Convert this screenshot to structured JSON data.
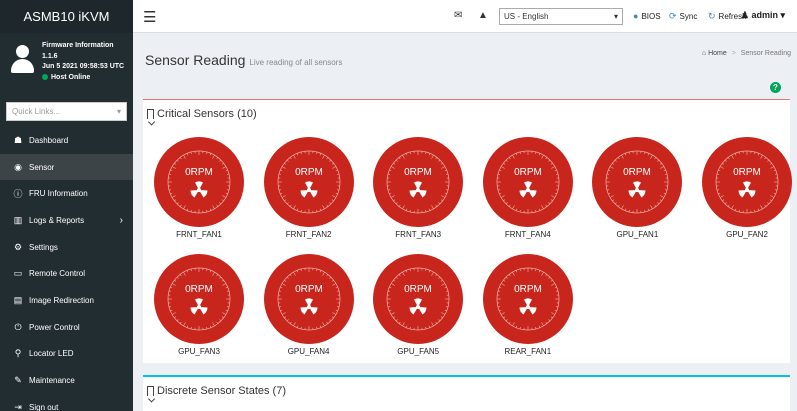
{
  "sidebar": {
    "logo": "ASMB10 iKVM",
    "user": {
      "title": "Firmware Information",
      "version": "1.1.6",
      "date": "Jun 5 2021 09:58:53 UTC",
      "status": "Host Online",
      "status_color": "#00a65a"
    },
    "quick_links": "Quick Links...",
    "items": [
      {
        "label": "Dashboard",
        "icon": "dashboard-icon",
        "glyph": "☗"
      },
      {
        "label": "Sensor",
        "icon": "sensor-icon",
        "glyph": "◉"
      },
      {
        "label": "FRU Information",
        "icon": "info-icon",
        "glyph": "ⓘ"
      },
      {
        "label": "Logs & Reports",
        "icon": "chart-icon",
        "glyph": "▥"
      },
      {
        "label": "Settings",
        "icon": "gear-icon",
        "glyph": "⚙"
      },
      {
        "label": "Remote Control",
        "icon": "monitor-icon",
        "glyph": "▭"
      },
      {
        "label": "Image Redirection",
        "icon": "drive-icon",
        "glyph": "▤"
      },
      {
        "label": "Power Control",
        "icon": "power-icon",
        "glyph": "⏻"
      },
      {
        "label": "Locator LED",
        "icon": "pin-icon",
        "glyph": "⚲"
      },
      {
        "label": "Maintenance",
        "icon": "wrench-icon",
        "glyph": "✎"
      },
      {
        "label": "Sign out",
        "icon": "signout-icon",
        "glyph": "⇥"
      }
    ]
  },
  "header": {
    "language": "US - English",
    "bios": "BIOS",
    "sync": "Sync",
    "refresh": "Refresh",
    "user": "admin"
  },
  "page": {
    "title": "Sensor Reading",
    "subtitle": "Live reading of all sensors",
    "breadcrumb": {
      "home": "Home",
      "current": "Sensor Reading"
    }
  },
  "critical": {
    "title": "Critical Sensors (10)",
    "reading": "0RPM",
    "gauge_color": "#c8261c",
    "sensors": [
      "FRNT_FAN1",
      "FRNT_FAN2",
      "FRNT_FAN3",
      "FRNT_FAN4",
      "GPU_FAN1",
      "GPU_FAN2",
      "GPU_FAN3",
      "GPU_FAN4",
      "GPU_FAN5",
      "REAR_FAN1"
    ]
  },
  "discrete": {
    "title": "Discrete Sensor States (7)"
  }
}
